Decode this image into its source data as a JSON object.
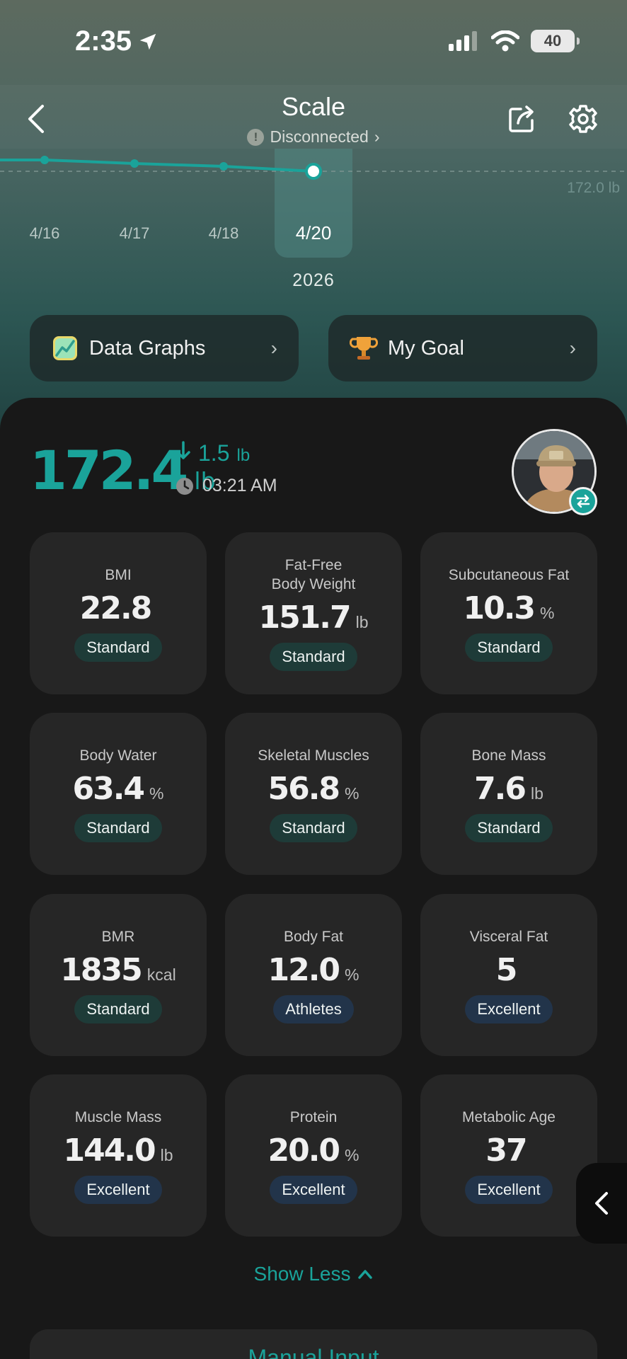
{
  "status_bar": {
    "time": "2:35",
    "battery": "40"
  },
  "nav": {
    "title": "Scale",
    "subtitle": "Disconnected",
    "subtitle_chevron": "›"
  },
  "graph": {
    "dates": [
      "4/16",
      "4/17",
      "4/18",
      "4/20"
    ],
    "selected_date": "4/20",
    "goal_line_label": "172.0 lb",
    "year": "2026",
    "line_color": "#1aa39a"
  },
  "quick_actions": [
    {
      "label": "Data Graphs",
      "icon": "chart-icon",
      "chevron": "›"
    },
    {
      "label": "My Goal",
      "icon": "trophy-icon",
      "chevron": "›"
    }
  ],
  "summary": {
    "weight": "172.4",
    "weight_unit": "lb",
    "delta": "1.5",
    "delta_unit": "lb",
    "delta_direction": "down",
    "time": "03:21 AM"
  },
  "metrics": [
    {
      "label": "BMI",
      "value": "22.8",
      "unit": "",
      "status": "Standard"
    },
    {
      "label": "Fat-Free\nBody Weight",
      "value": "151.7",
      "unit": "lb",
      "status": "Standard"
    },
    {
      "label": "Subcutaneous Fat",
      "value": "10.3",
      "unit": "%",
      "status": "Standard"
    },
    {
      "label": "Body Water",
      "value": "63.4",
      "unit": "%",
      "status": "Standard"
    },
    {
      "label": "Skeletal Muscles",
      "value": "56.8",
      "unit": "%",
      "status": "Standard"
    },
    {
      "label": "Bone Mass",
      "value": "7.6",
      "unit": "lb",
      "status": "Standard"
    },
    {
      "label": "BMR",
      "value": "1835",
      "unit": "kcal",
      "status": "Standard"
    },
    {
      "label": "Body Fat",
      "value": "12.0",
      "unit": "%",
      "status": "Athletes"
    },
    {
      "label": "Visceral Fat",
      "value": "5",
      "unit": "",
      "status": "Excellent"
    },
    {
      "label": "Muscle Mass",
      "value": "144.0",
      "unit": "lb",
      "status": "Excellent"
    },
    {
      "label": "Protein",
      "value": "20.0",
      "unit": "%",
      "status": "Excellent"
    },
    {
      "label": "Metabolic Age",
      "value": "37",
      "unit": "",
      "status": "Excellent"
    }
  ],
  "show_less": "Show Less",
  "manual_input": "Manual Input",
  "colors": {
    "accent": "#1aa39a",
    "card": "#262626",
    "panel": "#181818"
  }
}
